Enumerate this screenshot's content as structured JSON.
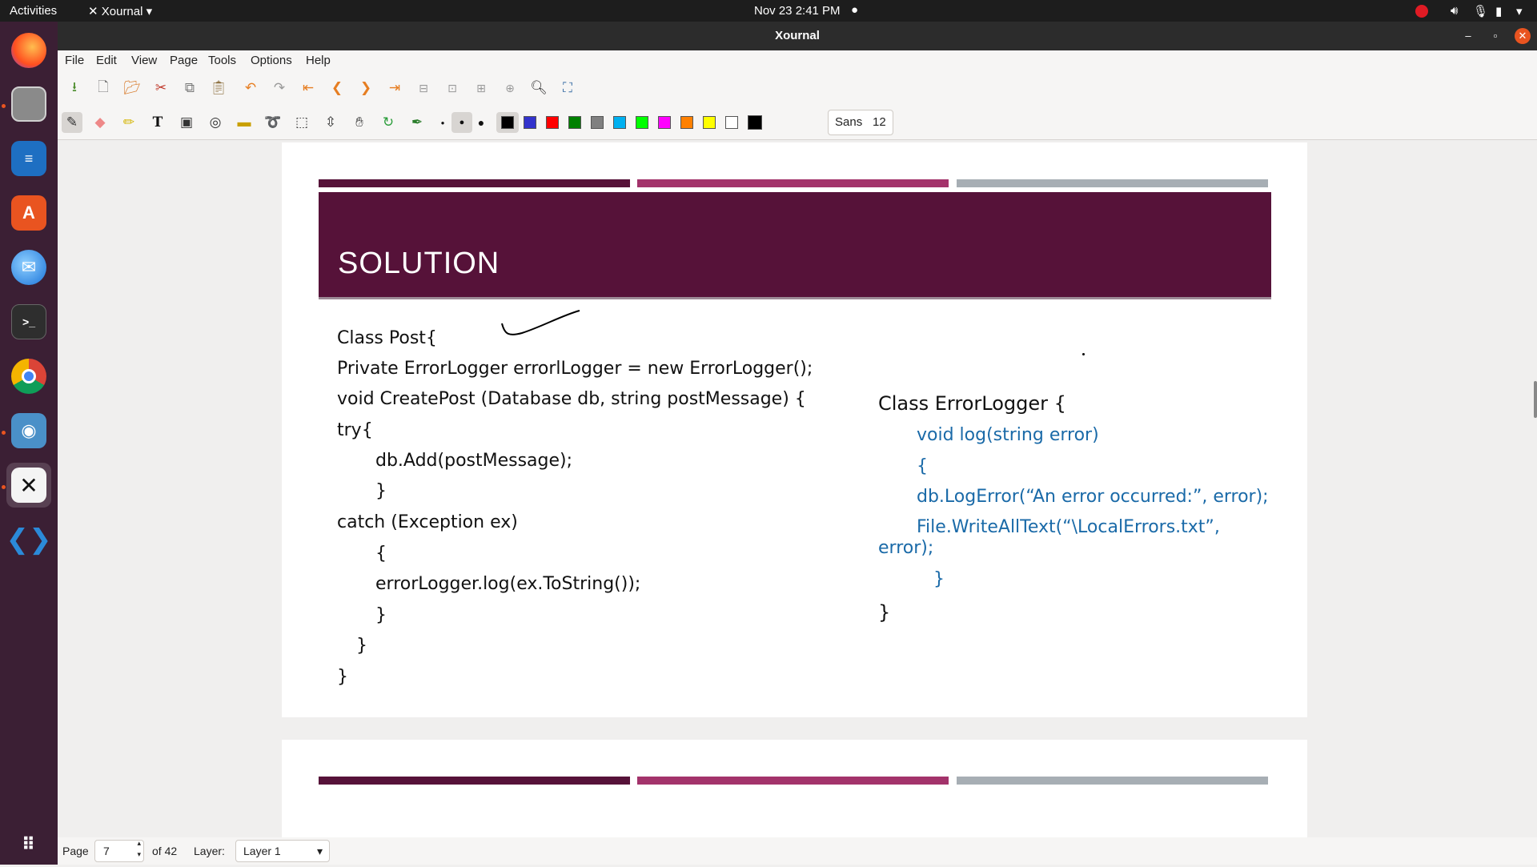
{
  "topbar": {
    "activities": "Activities",
    "app_menu": "Xournal",
    "clock": "Nov 23  2:41 PM"
  },
  "dock": {
    "items": [
      "Firefox",
      "Files",
      "LibreOffice Writer",
      "Ubuntu Software",
      "Thunderbird",
      "Terminal",
      "Google Chrome",
      "Screenshot",
      "Xournal",
      "Visual Studio Code",
      "Show Applications"
    ]
  },
  "window": {
    "title": "Xournal"
  },
  "menu": [
    "File",
    "Edit",
    "View",
    "Page",
    "Tools",
    "Options",
    "Help"
  ],
  "toolbar": {
    "font_name": "Sans",
    "font_size": "12",
    "colors": [
      "#000000",
      "#3333cc",
      "#ff0000",
      "#008000",
      "#808080",
      "#00b0f0",
      "#00ff00",
      "#ff00ff",
      "#ff8000",
      "#ffff00",
      "#ffffff",
      "#000000"
    ]
  },
  "slide": {
    "title": "SOLUTION",
    "left_code": [
      "Class Post{",
      "Private ErrorLogger errorlLogger = new ErrorLogger();",
      "void CreatePost (Database db, string postMessage) {",
      "try{",
      "db.Add(postMessage);",
      "}",
      "catch (Exception ex)",
      "{",
      "errorLogger.log(ex.ToString());",
      "}",
      "}",
      "}"
    ],
    "right_title": "Class ErrorLogger {",
    "right_code": [
      "void log(string error)",
      "{",
      "db.LogError(“An error occurred:”, error);",
      "File.WriteAllText(“\\LocalErrors.txt”,",
      "error);",
      "}"
    ],
    "right_close": "}",
    "accent_colors": {
      "banner": "#561239",
      "bar1": "#561239",
      "bar2": "#a3336b",
      "bar3": "#a7aeb4"
    }
  },
  "statusbar": {
    "page_label": "Page",
    "page_value": "7",
    "page_total": "of 42",
    "layer_label": "Layer:",
    "layer_value": "Layer 1"
  }
}
